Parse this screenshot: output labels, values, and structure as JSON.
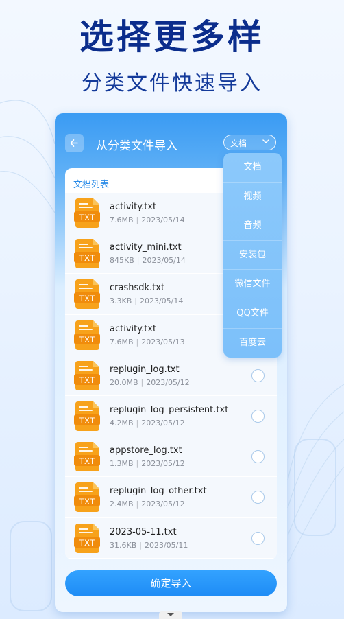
{
  "headline": "选择更多样",
  "subline": "分类文件快速导入",
  "topbar": {
    "back_icon": "back-arrow-icon",
    "title": "从分类文件导入",
    "type_select_value": "文档"
  },
  "list": {
    "title": "文档列表",
    "files": [
      {
        "name": "activity.txt",
        "size": "7.6MB",
        "date": "2023/05/14",
        "icon_label": "TXT"
      },
      {
        "name": "activity_mini.txt",
        "size": "845KB",
        "date": "2023/05/14",
        "icon_label": "TXT"
      },
      {
        "name": "crashsdk.txt",
        "size": "3.3KB",
        "date": "2023/05/14",
        "icon_label": "TXT"
      },
      {
        "name": "activity.txt",
        "size": "7.6MB",
        "date": "2023/05/13",
        "icon_label": "TXT"
      },
      {
        "name": "replugin_log.txt",
        "size": "20.0MB",
        "date": "2023/05/12",
        "icon_label": "TXT"
      },
      {
        "name": "replugin_log_persistent.txt",
        "size": "4.2MB",
        "date": "2023/05/12",
        "icon_label": "TXT"
      },
      {
        "name": "appstore_log.txt",
        "size": "1.3MB",
        "date": "2023/05/12",
        "icon_label": "TXT"
      },
      {
        "name": "replugin_log_other.txt",
        "size": "2.4MB",
        "date": "2023/05/12",
        "icon_label": "TXT"
      },
      {
        "name": "2023-05-11.txt",
        "size": "31.6KB",
        "date": "2023/05/11",
        "icon_label": "TXT"
      }
    ],
    "meta_separator": "|"
  },
  "dropdown": {
    "items": [
      "文档",
      "视频",
      "音频",
      "安装包",
      "微信文件",
      "QQ文件",
      "百度云"
    ]
  },
  "confirm_label": "确定导入",
  "colors": {
    "headline": "#0b2d8c",
    "accent": "#2b8ce8",
    "button": "#1e8cf5",
    "file_icon": "#f7a21b",
    "dropdown_bg": "#85c5fa"
  }
}
